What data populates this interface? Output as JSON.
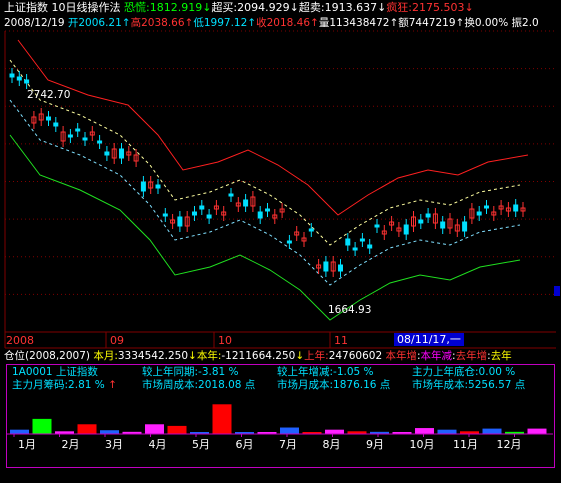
{
  "colors": {
    "up": "#ff3232",
    "down": "#00e0ff",
    "white": "#ffffff",
    "yellow": "#ffff00",
    "green": "#00ff00",
    "red": "#ff3232",
    "cyan": "#00e0ff",
    "magenta": "#ff00ff",
    "grid": "#800000",
    "blue": "#0000a0"
  },
  "header": {
    "title": "上证指数",
    "subtitle": "10日线操作法",
    "fear_label": "恐慌:",
    "fear_value": "1812.919",
    "fear_arrow": "↓",
    "overbuy_label": "超买:",
    "overbuy_value": "2094.929",
    "overbuy_arrow": "↓",
    "oversell_label": "超卖:",
    "oversell_value": "1913.637",
    "oversell_arrow": "↓",
    "crazy_label": "疯狂:",
    "crazy_value": "2175.503",
    "crazy_arrow": "↓"
  },
  "quote": {
    "date": "2008/12/19",
    "open_label": "开",
    "open": "2006.21",
    "open_arrow": "↑",
    "high_label": "高",
    "high": "2038.66",
    "high_arrow": "↑",
    "low_label": "低",
    "low": "1997.12",
    "low_arrow": "↑",
    "close_label": "收",
    "close": "2018.46",
    "close_arrow": "↑",
    "volume_label": "量",
    "volume": "113438472",
    "volume_arrow": "↑",
    "amount_label": "额",
    "amount": "7447219",
    "amount_arrow": "↑",
    "turnover_label": "换",
    "turnover": "0.00%",
    "amplitude_label": "振",
    "amplitude": "2.0"
  },
  "annotations": {
    "high_mark": "2742.70",
    "low_mark": "1664.93"
  },
  "months": {
    "m1": "2008",
    "m2": "09",
    "m3": "10",
    "m4": "11",
    "date_box": "08/11/17,一"
  },
  "position_bar": {
    "label": "仓位(2008,2007)",
    "this_month_label": "本月:",
    "this_month": "3334542.250",
    "this_month_arrow": "↓",
    "this_year_label": "本年:",
    "this_year": "-1211664.250",
    "this_year_arrow": "↓",
    "last_year_label": "上年:",
    "last_year": "24760602",
    "inc_label": "本年增",
    "dec_label": "本年减",
    "last_inc_label": "去年增",
    "last_dec_label": "去年"
  },
  "stats": {
    "code": "1A0001",
    "name": "上证指数",
    "yoy_label": "较上年同期:",
    "yoy": "-3.81 %",
    "growth_label": "较上年增减:",
    "growth": "-1.05 %",
    "bottom_label": "主力上年底仓:",
    "bottom": "0.00 %",
    "chips_label": "主力月筹码:",
    "chips": "2.81 %",
    "chips_arrow": "↑",
    "week_cost_label": "市场周成本:",
    "week_cost": "2018.08 点",
    "month_cost_label": "市场月成本:",
    "month_cost": "1876.16 点",
    "year_cost_label": "市场年成本:",
    "year_cost": "5256.57 点"
  },
  "bar_chart": {
    "months": [
      "1月",
      "2月",
      "3月",
      "4月",
      "5月",
      "6月",
      "7月",
      "8月",
      "9月",
      "10月",
      "11月",
      "12月"
    ],
    "bars": [
      {
        "v": 0.08,
        "c": "blue"
      },
      {
        "v": 0.28,
        "c": "green"
      },
      {
        "v": 0.05,
        "c": "magenta"
      },
      {
        "v": 0.18,
        "c": "red"
      },
      {
        "v": 0.07,
        "c": "blue"
      },
      {
        "v": 0.04,
        "c": "magenta"
      },
      {
        "v": 0.18,
        "c": "magenta"
      },
      {
        "v": 0.15,
        "c": "red"
      },
      {
        "v": 0.02,
        "c": "blue"
      },
      {
        "v": 0.55,
        "c": "red"
      },
      {
        "v": 0.03,
        "c": "blue"
      },
      {
        "v": 0.02,
        "c": "magenta"
      },
      {
        "v": 0.12,
        "c": "blue"
      },
      {
        "v": 0.03,
        "c": "red"
      },
      {
        "v": 0.08,
        "c": "magenta"
      },
      {
        "v": 0.05,
        "c": "red"
      },
      {
        "v": 0.04,
        "c": "blue"
      },
      {
        "v": 0.03,
        "c": "magenta"
      },
      {
        "v": 0.11,
        "c": "magenta"
      },
      {
        "v": 0.08,
        "c": "blue"
      },
      {
        "v": 0.05,
        "c": "red"
      },
      {
        "v": 0.1,
        "c": "blue"
      },
      {
        "v": 0.04,
        "c": "green"
      },
      {
        "v": 0.1,
        "c": "magenta"
      }
    ]
  }
}
